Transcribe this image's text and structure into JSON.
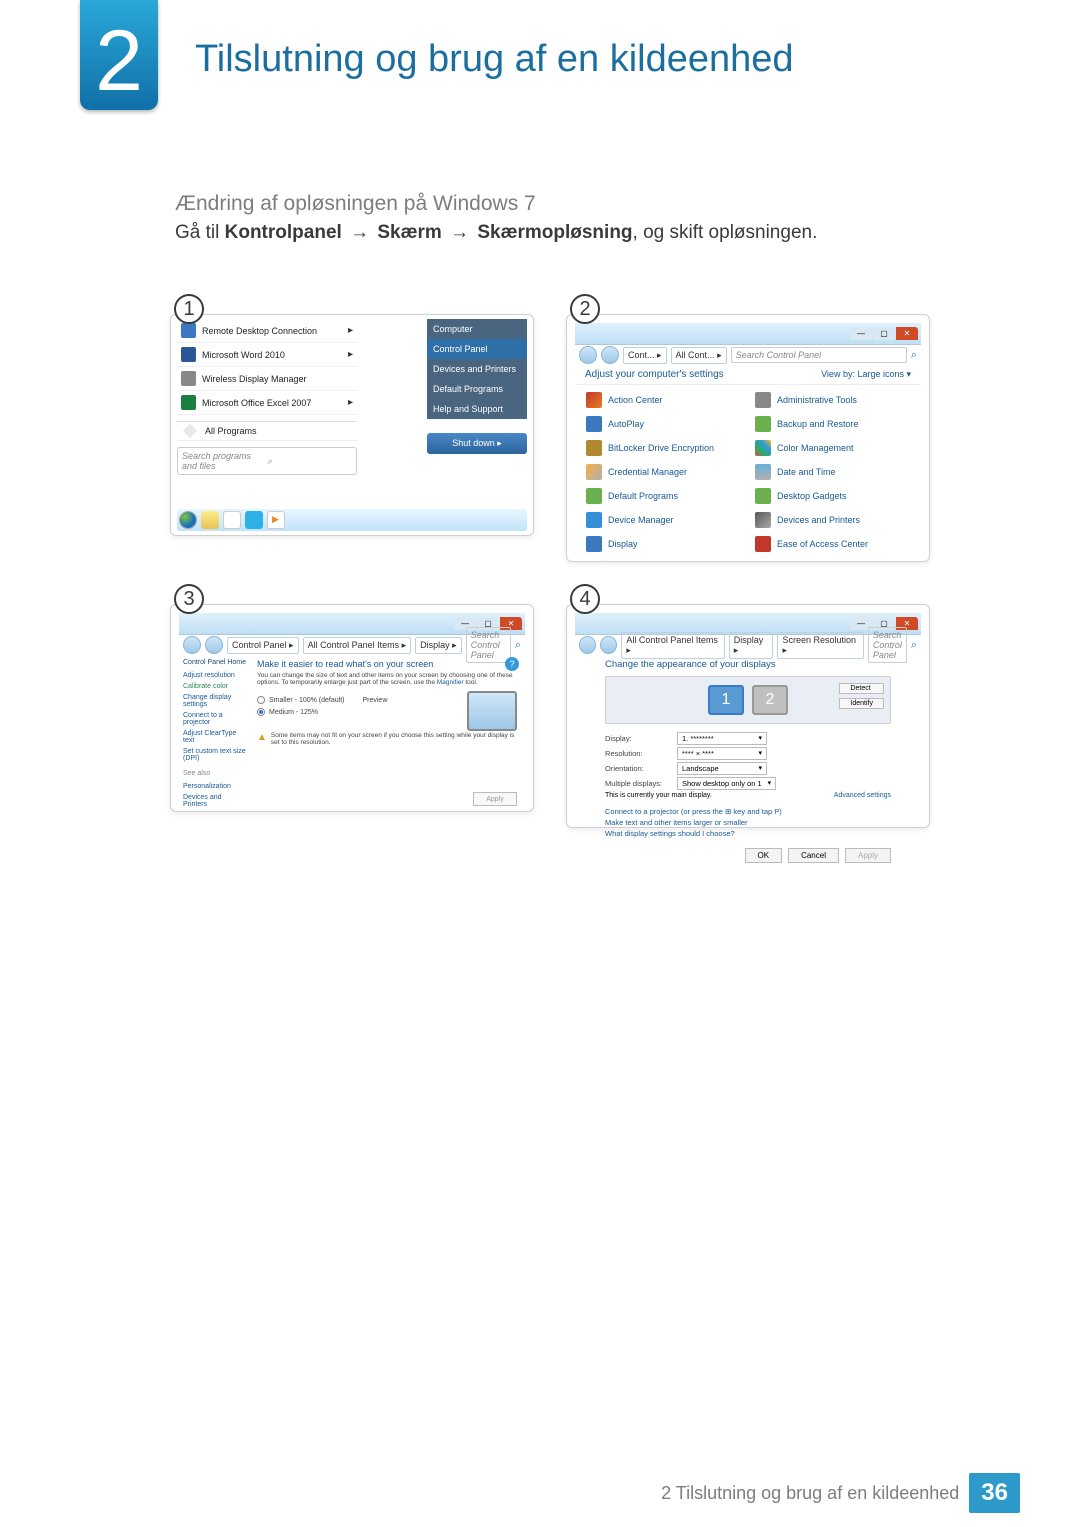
{
  "chapter": {
    "number": "2",
    "title": "Tilslutning og brug af en kildeenhed"
  },
  "section": {
    "heading": "Ændring af opløsningen på Windows 7"
  },
  "instruction": {
    "prefix": "Gå til ",
    "b1": "Kontrolpanel",
    "b2": "Skærm",
    "b3": "Skærmopløsning",
    "suffix": ", og skift opløsningen."
  },
  "steps": {
    "s1": "1",
    "s2": "2",
    "s3": "3",
    "s4": "4"
  },
  "startmenu": {
    "left": {
      "rdc": "Remote Desktop Connection",
      "word": "Microsoft Word 2010",
      "wdm": "Wireless Display Manager",
      "excel": "Microsoft Office Excel 2007",
      "allprograms": "All Programs",
      "search": "Search programs and files"
    },
    "right": {
      "computer": "Computer",
      "controlpanel": "Control Panel",
      "devices": "Devices and Printers",
      "defaults": "Default Programs",
      "help": "Help and Support",
      "shutdown": "Shut down   ▸"
    }
  },
  "cp2": {
    "crumb1": "Cont...",
    "crumb2": "All Cont...",
    "search": "Search Control Panel",
    "header": "Adjust your computer's settings",
    "view": "View by:  Large icons ▾",
    "items": {
      "action": "Action Center",
      "admin": "Administrative Tools",
      "autoplay": "AutoPlay",
      "backup": "Backup and Restore",
      "bitlocker": "BitLocker Drive Encryption",
      "color": "Color Management",
      "cred": "Credential Manager",
      "date": "Date and Time",
      "defprog": "Default Programs",
      "gadgets": "Desktop Gadgets",
      "devmgr": "Device Manager",
      "devprn": "Devices and Printers",
      "display": "Display",
      "ease": "Ease of Access Center"
    }
  },
  "cp3": {
    "crumb1": "Control Panel",
    "crumb2": "All Control Panel Items",
    "crumb3": "Display",
    "search": "Search Control Panel",
    "left": {
      "home": "Control Panel Home",
      "adjres": "Adjust resolution",
      "calib": "Calibrate color",
      "chgdisp": "Change display settings",
      "proj": "Connect to a projector",
      "cleartype": "Adjust ClearType text",
      "dpi": "Set custom text size (DPI)",
      "seealso": "See also",
      "personal": "Personalization",
      "devprn": "Devices and Printers"
    },
    "main": {
      "title": "Make it easier to read what's on your screen",
      "desc_a": "You can change the size of text and other items on your screen by choosing one of these options. To temporarily enlarge just part of the screen, use the ",
      "desc_link": "Magnifier",
      "desc_b": " tool.",
      "r1": "Smaller - 100% (default)",
      "r1b": "Preview",
      "r2": "Medium - 125%",
      "warn": "Some items may not fit on your screen if you choose this setting while your display is set to this resolution.",
      "apply": "Apply"
    }
  },
  "cp4": {
    "crumb1": "All Control Panel Items",
    "crumb2": "Display",
    "crumb3": "Screen Resolution",
    "search": "Search Control Panel",
    "title": "Change the appearance of your displays",
    "detect": "Detect",
    "identify": "Identify",
    "mon1": "1",
    "mon2": "2",
    "rows": {
      "display_l": "Display:",
      "display_v": "1. ********",
      "res_l": "Resolution:",
      "res_v": "**** × ****",
      "orient_l": "Orientation:",
      "orient_v": "Landscape",
      "multi_l": "Multiple displays:",
      "multi_v": "Show desktop only on 1"
    },
    "note": "This is currently your main display.",
    "adv": "Advanced settings",
    "links": {
      "proj": "Connect to a projector (or press the ⊞ key and tap P)",
      "larger": "Make text and other items larger or smaller",
      "what": "What display settings should I choose?"
    },
    "buttons": {
      "ok": "OK",
      "cancel": "Cancel",
      "apply": "Apply"
    }
  },
  "footer": {
    "text": "2 Tilslutning og brug af en kildeenhed",
    "page": "36"
  }
}
